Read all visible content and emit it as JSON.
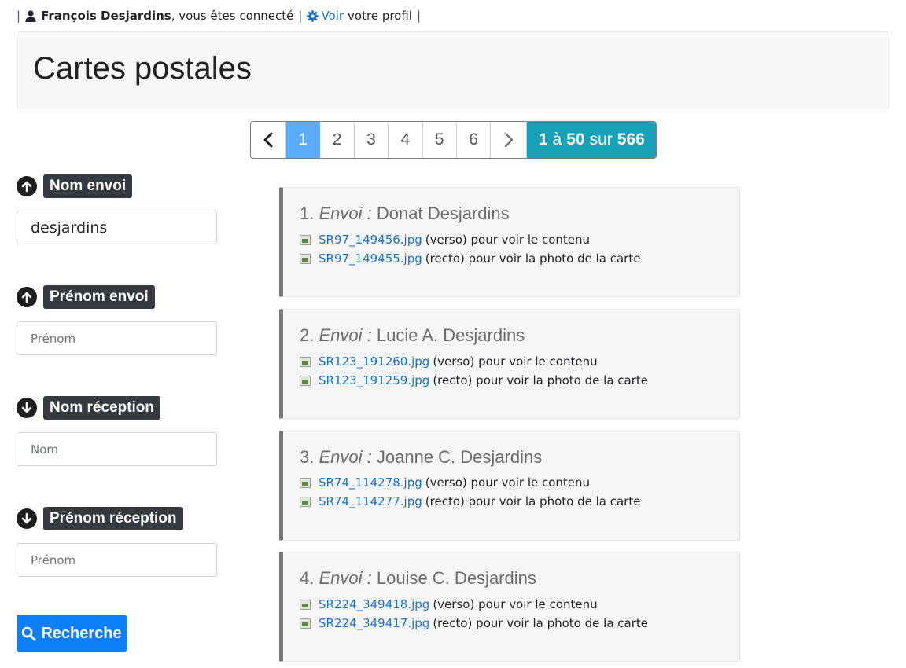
{
  "topbar": {
    "pipe": "|",
    "user_name": "François Desjardins",
    "connected_text": ", vous êtes connecté",
    "profile_link": "Voir",
    "profile_text": "votre profil"
  },
  "page": {
    "title": "Cartes postales"
  },
  "pagination": {
    "pages": [
      "1",
      "2",
      "3",
      "4",
      "5",
      "6"
    ],
    "active_page": "1",
    "range_from": "1",
    "range_sep": "à",
    "range_to": "50",
    "total_sep": "sur",
    "total": "566"
  },
  "filters": {
    "nom_envoi": {
      "label": "Nom envoi",
      "value": "desjardins",
      "sort": "up"
    },
    "prenom_envoi": {
      "label": "Prénom envoi",
      "placeholder": "Prénom",
      "sort": "up"
    },
    "nom_reception": {
      "label": "Nom réception",
      "placeholder": "Nom",
      "sort": "down"
    },
    "prenom_reception": {
      "label": "Prénom réception",
      "placeholder": "Prénom",
      "sort": "down"
    },
    "search_button": "Recherche"
  },
  "results": [
    {
      "index": "1.",
      "label": "Envoi :",
      "name": "Donat Desjardins",
      "verso_file": "SR97_149456.jpg",
      "verso_text": "(verso) pour voir le contenu",
      "recto_file": "SR97_149455.jpg",
      "recto_text": "(recto) pour voir la photo de la carte"
    },
    {
      "index": "2.",
      "label": "Envoi :",
      "name": "Lucie A. Desjardins",
      "verso_file": "SR123_191260.jpg",
      "verso_text": "(verso) pour voir le contenu",
      "recto_file": "SR123_191259.jpg",
      "recto_text": "(recto) pour voir la photo de la carte"
    },
    {
      "index": "3.",
      "label": "Envoi :",
      "name": "Joanne C. Desjardins",
      "verso_file": "SR74_114278.jpg",
      "verso_text": "(verso) pour voir le contenu",
      "recto_file": "SR74_114277.jpg",
      "recto_text": "(recto) pour voir la photo de la carte"
    },
    {
      "index": "4.",
      "label": "Envoi :",
      "name": "Louise C. Desjardins",
      "verso_file": "SR224_349418.jpg",
      "verso_text": "(verso) pour voir le contenu",
      "recto_file": "SR224_349417.jpg",
      "recto_text": "(recto) pour voir la photo de la carte"
    }
  ],
  "colors": {
    "link": "#1a73c9",
    "active_page": "#5aabf7",
    "count_badge": "#17a2b8",
    "search_button": "#0d7ff9",
    "label_badge": "#343a40"
  },
  "icons": {
    "user": "user-icon",
    "profile": "gear-icon",
    "sort_up": "arrow-circle-up-icon",
    "sort_down": "arrow-circle-down-icon",
    "search": "search-icon",
    "file": "image-file-icon"
  }
}
